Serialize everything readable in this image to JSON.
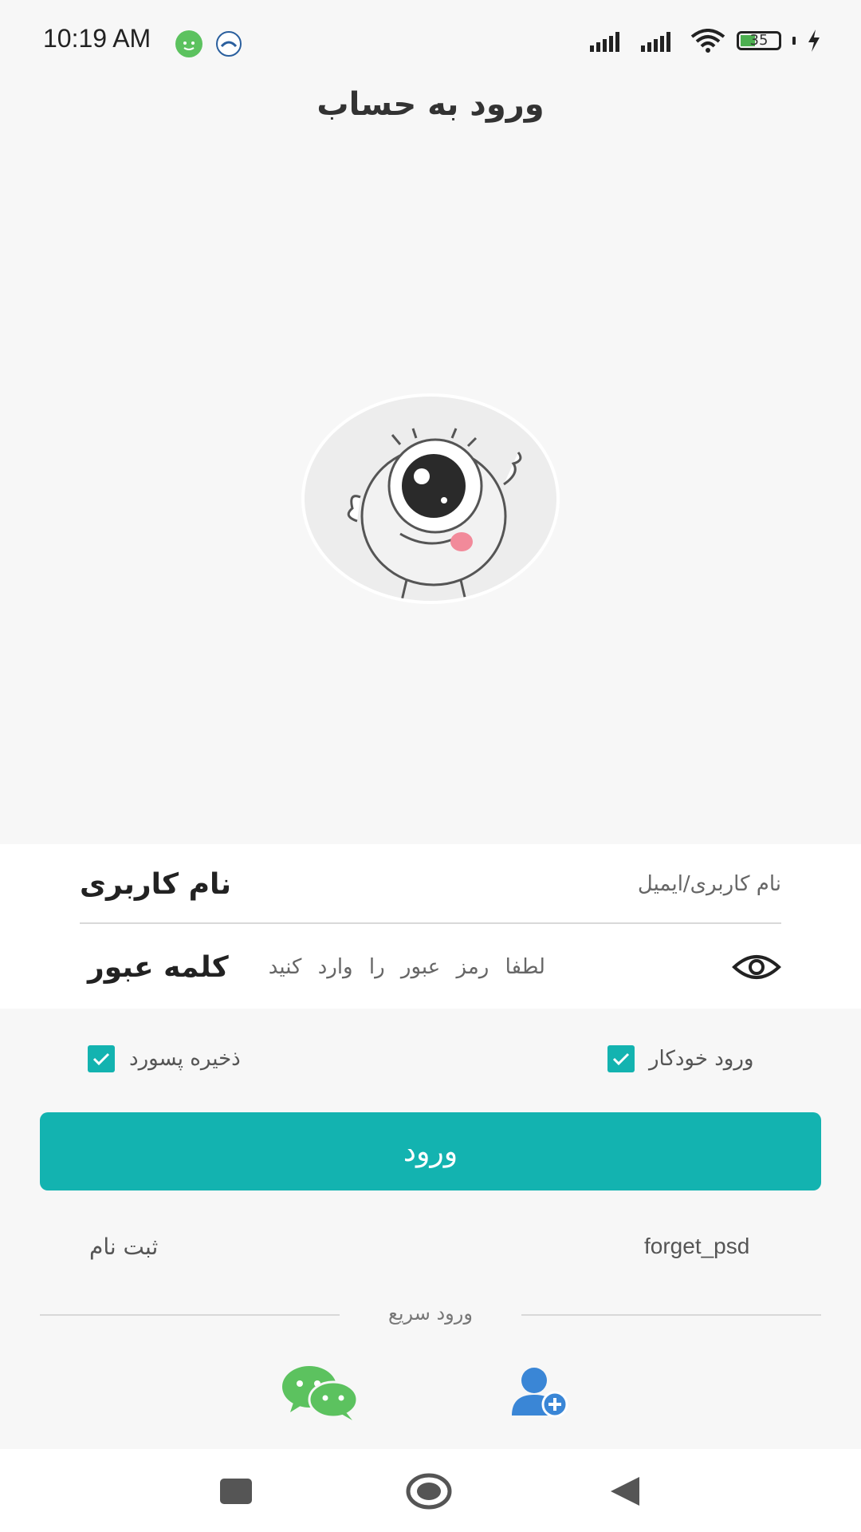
{
  "status_bar": {
    "time": "10:19 AM",
    "battery": "35"
  },
  "header": {
    "title": "ورود به حساب"
  },
  "form": {
    "username_label": "نام کاربری",
    "username_placeholder": "نام کاربری/ایمیل",
    "password_label": "کلمه عبور",
    "password_placeholder": "لطفا رمز عبور را وارد کنید"
  },
  "options": {
    "auto_login": "ورود خودکار",
    "save_password": "ذخیره پسورد"
  },
  "login_button": "ورود",
  "links": {
    "forget_password": "forget_psd",
    "register": "ثبت نام"
  },
  "quick_login": {
    "label": "ورود سریع"
  },
  "colors": {
    "accent": "#13b3b0",
    "wechat": "#5cc25f",
    "add_user": "#3a86d6"
  }
}
